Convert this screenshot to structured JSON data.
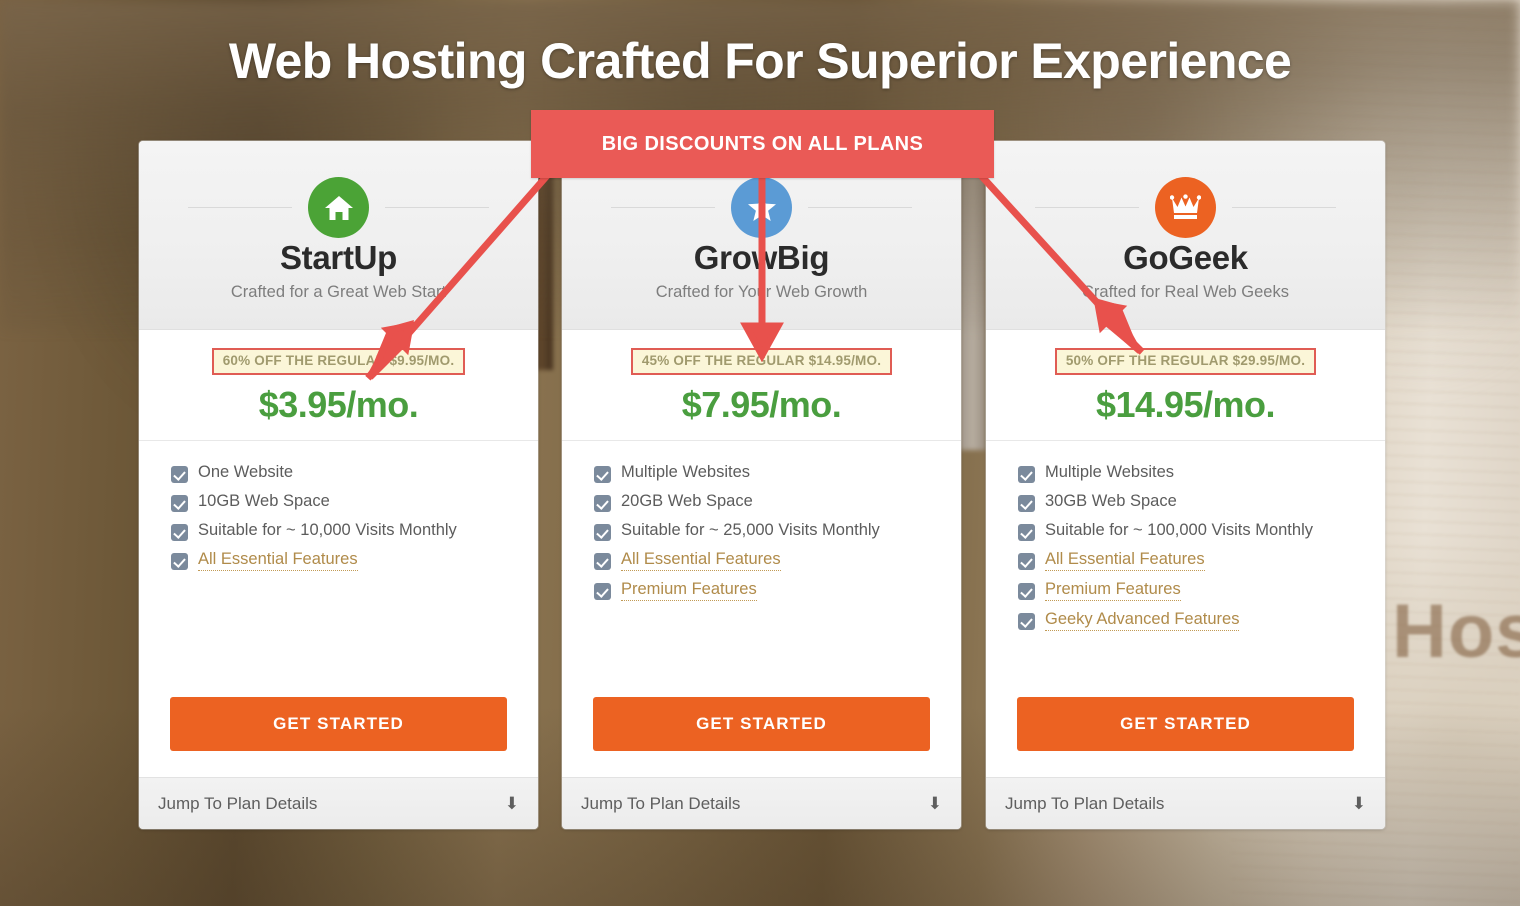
{
  "page": {
    "title": "Web Hosting Crafted For Superior Experience",
    "background_description": "blurred wood workbench photo",
    "background_watermark": "Hos"
  },
  "promo_banner": {
    "text": "BIG DISCOUNTS ON ALL PLANS",
    "color": "#ea5a56",
    "text_color": "#ffffff"
  },
  "colors": {
    "accent_orange": "#ec6222",
    "price_green": "#4a9e3f",
    "promo_red": "#ea5a56",
    "badge_bg": "#fbf6d8",
    "badge_border": "#e05c54",
    "badge_text": "#a09a6e",
    "checkbox": "#7b8a9c",
    "feature_link": "#b08b4a"
  },
  "plans": [
    {
      "icon": "home-icon",
      "icon_color": "#4ba336",
      "name": "StartUp",
      "tagline": "Crafted for a Great Web Start",
      "discount": "60% OFF THE REGULAR $9.95/MO.",
      "price": "$3.95/mo.",
      "features": [
        {
          "label": "One Website",
          "link": false
        },
        {
          "label": "10GB Web Space",
          "link": false
        },
        {
          "label": "Suitable for ~ 10,000 Visits Monthly",
          "link": false
        },
        {
          "label": "All Essential Features",
          "link": true
        }
      ],
      "cta": "GET STARTED",
      "footer": "Jump To Plan Details",
      "footer_icon": "down-arrow-icon"
    },
    {
      "icon": "star-icon",
      "icon_color": "#5b9bd5",
      "name": "GrowBig",
      "tagline": "Crafted for Your Web Growth",
      "discount": "45% OFF THE REGULAR $14.95/MO.",
      "price": "$7.95/mo.",
      "features": [
        {
          "label": "Multiple Websites",
          "link": false
        },
        {
          "label": "20GB Web Space",
          "link": false
        },
        {
          "label": "Suitable for ~ 25,000 Visits Monthly",
          "link": false
        },
        {
          "label": "All Essential Features",
          "link": true
        },
        {
          "label": "Premium Features",
          "link": true
        }
      ],
      "cta": "GET STARTED",
      "footer": "Jump To Plan Details",
      "footer_icon": "down-arrow-icon"
    },
    {
      "icon": "crown-icon",
      "icon_color": "#ec6222",
      "name": "GoGeek",
      "tagline": "Crafted for Real Web Geeks",
      "discount": "50% OFF THE REGULAR $29.95/MO.",
      "price": "$14.95/mo.",
      "features": [
        {
          "label": "Multiple Websites",
          "link": false
        },
        {
          "label": "30GB Web Space",
          "link": false
        },
        {
          "label": "Suitable for ~ 100,000 Visits Monthly",
          "link": false
        },
        {
          "label": "All Essential Features",
          "link": true
        },
        {
          "label": "Premium Features",
          "link": true
        },
        {
          "label": "Geeky Advanced Features",
          "link": true
        }
      ],
      "cta": "GET STARTED",
      "footer": "Jump To Plan Details",
      "footer_icon": "down-arrow-icon"
    }
  ]
}
